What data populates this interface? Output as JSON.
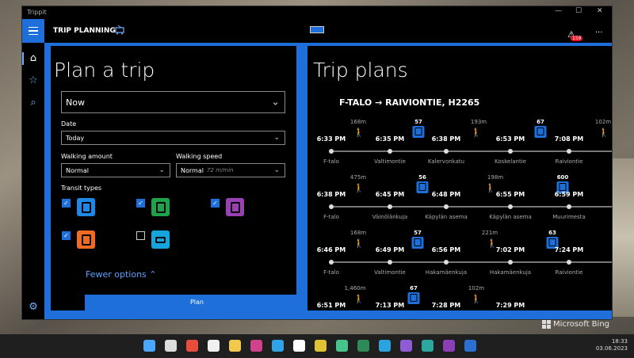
{
  "window": {
    "title": "Trippit",
    "minimize": "—",
    "maximize": "☐",
    "close": "✕"
  },
  "app": {
    "header": "TRIP PLANNING",
    "alert_count": "159",
    "more": "···"
  },
  "left": {
    "heading": "Plan a trip",
    "time_value": "Now",
    "date_label": "Date",
    "date_value": "Today",
    "walking_amount_label": "Walking amount",
    "walking_amount_value": "Normal",
    "walking_speed_label": "Walking speed",
    "walking_speed_value": "Normal",
    "walking_speed_hint": "72 m/min",
    "transit_label": "Transit types",
    "transit": [
      {
        "name": "bus",
        "checked": true,
        "color": "#1e88e5"
      },
      {
        "name": "tram",
        "checked": true,
        "color": "#1fa34a"
      },
      {
        "name": "train",
        "checked": true,
        "color": "#9b3fb5"
      },
      {
        "name": "metro",
        "checked": true,
        "color": "#f06b22"
      },
      {
        "name": "ferry",
        "checked": false,
        "color": "#14a5dc"
      }
    ],
    "fewer_options": "Fewer options ⌃",
    "plan_button": "Plan"
  },
  "right": {
    "heading": "Trip plans",
    "route_title": "F-TALO → RAIVIONTIE, H2265",
    "plans": [
      {
        "times": [
          "6:33 PM",
          "6:35 PM",
          "6:38 PM",
          "6:53 PM",
          "7:08 PM"
        ],
        "stops": [
          "F-talo",
          "Valtimontie",
          "Kalervonkatu",
          "Koskelantie",
          "Raiviontie"
        ],
        "dists": [
          "168m",
          "193m",
          "102m"
        ],
        "buses": [
          "57",
          "67"
        ]
      },
      {
        "times": [
          "6:38 PM",
          "6:45 PM",
          "6:48 PM",
          "6:55 PM",
          "6:59 PM"
        ],
        "stops": [
          "F-talo",
          "Väinölänkuja",
          "Käpylän asema",
          "Käpylän asema",
          "Muurimesta"
        ],
        "dists": [
          "475m",
          "198m"
        ],
        "buses": [
          "56",
          "600"
        ]
      },
      {
        "times": [
          "6:46 PM",
          "6:49 PM",
          "6:56 PM",
          "7:02 PM",
          "7:24 PM"
        ],
        "stops": [
          "F-talo",
          "Valtimontie",
          "Hakamäenkuja",
          "Hakamäenkuja",
          "Raiviontie"
        ],
        "dists": [
          "168m",
          "221m"
        ],
        "buses": [
          "57",
          "63"
        ]
      },
      {
        "times": [
          "6:51 PM",
          "7:13 PM",
          "7:28 PM",
          "7:29 PM"
        ],
        "stops": [],
        "dists": [
          "1,460m",
          "102m"
        ],
        "buses": [
          "67"
        ]
      }
    ]
  },
  "desktop": {
    "watermark": "Microsoft Bing",
    "time": "18:33",
    "date": "03.06.2023"
  },
  "taskbar_icons": [
    "windows-icon",
    "search-icon",
    "app-red",
    "store-icon",
    "folder-icon",
    "save-icon",
    "edge-icon",
    "yandex-icon",
    "chrome-icon",
    "notes-icon",
    "excel-icon",
    "telegram-icon",
    "vs-icon",
    "app-icon",
    "onenote-icon",
    "word-icon"
  ]
}
